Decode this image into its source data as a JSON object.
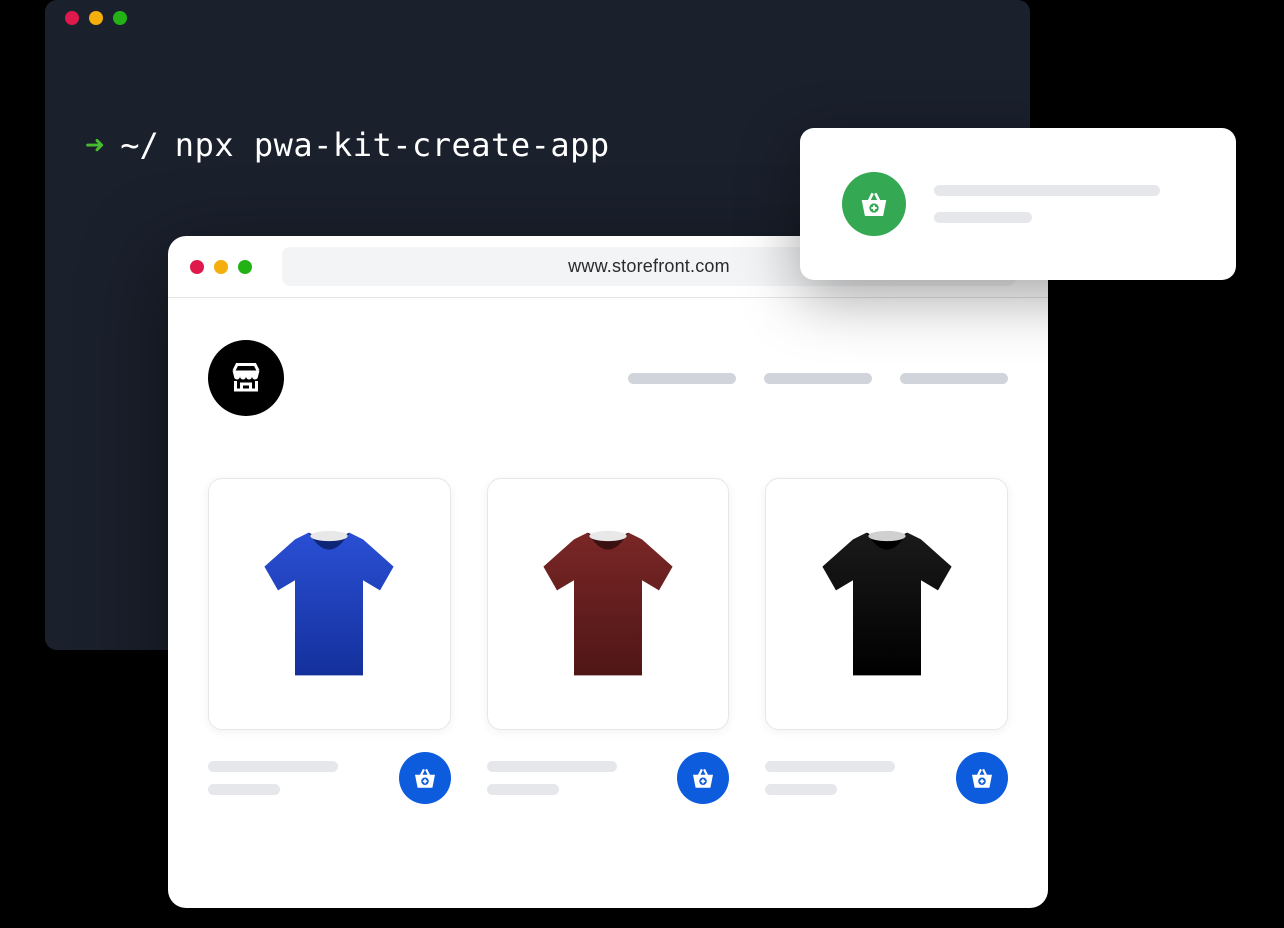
{
  "terminal": {
    "prompt": "~/",
    "command": "npx pwa-kit-create-app"
  },
  "browser": {
    "url": "www.storefront.com",
    "logo_name": "store-logo"
  },
  "products": [
    {
      "color": "#1b3db8",
      "name": "blue-tshirt"
    },
    {
      "color": "#6b1e1e",
      "name": "maroon-tshirt"
    },
    {
      "color": "#0a0a0a",
      "name": "black-tshirt"
    }
  ],
  "notification": {
    "icon_name": "basket-add-icon"
  }
}
